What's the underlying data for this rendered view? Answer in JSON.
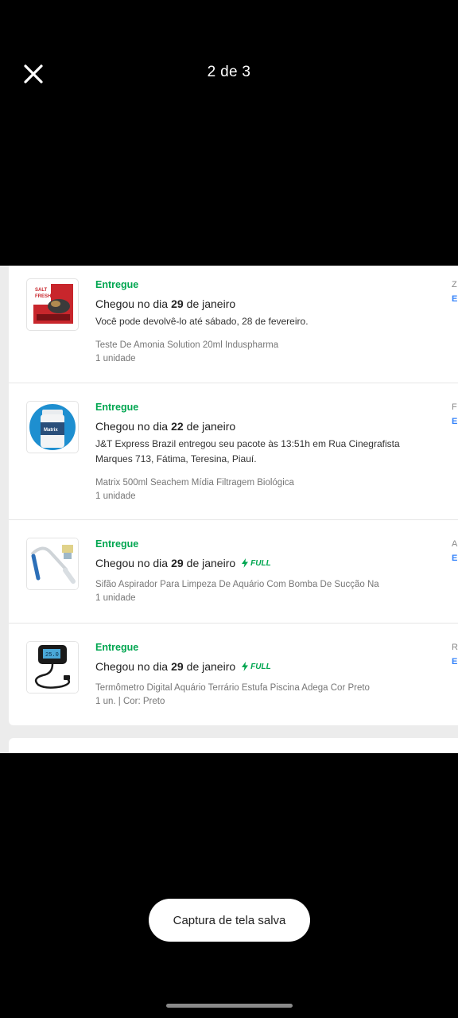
{
  "viewer": {
    "page_indicator": "2 de 3",
    "close_icon": "close-icon"
  },
  "orders": [
    {
      "status": "Entregue",
      "title_prefix": "Chegou no dia",
      "day": "29",
      "title_suffix": "de janeiro",
      "full": false,
      "desc": "Você pode devolvê-lo até sábado, 28 de fevereiro.",
      "product": "Teste De Amonia Solution 20ml Induspharma",
      "qty": "1 unidade",
      "side_letter": "Z",
      "side_link": "E"
    },
    {
      "status": "Entregue",
      "title_prefix": "Chegou no dia",
      "day": "22",
      "title_suffix": "de janeiro",
      "full": false,
      "desc": "J&T Express Brazil entregou seu pacote às 13:51h em Rua Cinegrafista Marques 713, Fátima, Teresina, Piauí.",
      "product": "Matrix 500ml Seachem Mídia Filtragem Biológica",
      "qty": "1 unidade",
      "side_letter": "F",
      "side_link": "E"
    },
    {
      "status": "Entregue",
      "title_prefix": "Chegou no dia",
      "day": "29",
      "title_suffix": "de janeiro",
      "full": true,
      "full_label": "FULL",
      "desc": "",
      "product": "Sifão Aspirador Para Limpeza De Aquário Com Bomba De Sucção Na",
      "qty": "1 unidade",
      "side_letter": "A",
      "side_link": "E"
    },
    {
      "status": "Entregue",
      "title_prefix": "Chegou no dia",
      "day": "29",
      "title_suffix": "de janeiro",
      "full": true,
      "full_label": "FULL",
      "desc": "",
      "product": "Termômetro Digital Aquário Terrário Estufa Piscina Adega Cor Preto",
      "qty": "1 un. | Cor: Preto",
      "side_letter": "R",
      "side_link": "E"
    }
  ],
  "toast": {
    "text": "Captura de tela salva"
  },
  "colors": {
    "status_green": "#00a650",
    "link_blue": "#3483fa",
    "background": "#000000"
  }
}
